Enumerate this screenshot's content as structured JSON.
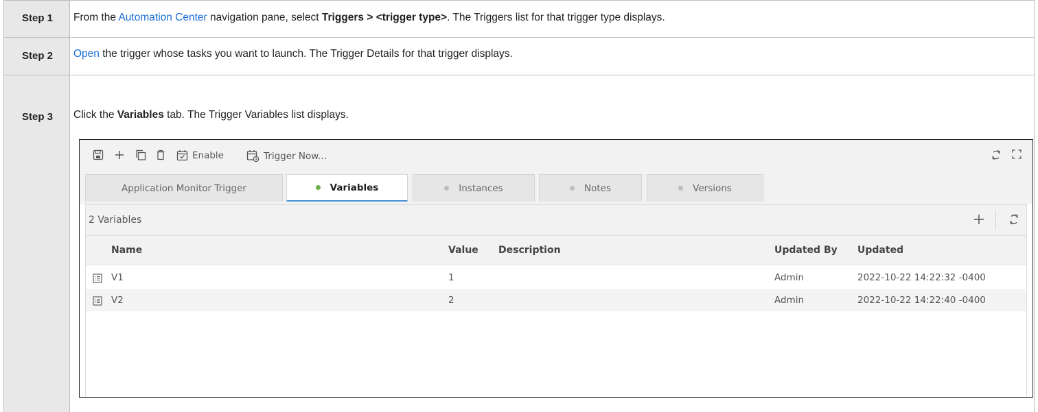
{
  "steps": [
    {
      "label": "Step 1",
      "parts": [
        {
          "t": "From the "
        },
        {
          "t": "Automation Center",
          "link": true
        },
        {
          "t": " navigation pane, select "
        },
        {
          "t": "Triggers > <trigger type>",
          "bold": true
        },
        {
          "t": ". The Triggers list for that trigger type displays."
        }
      ]
    },
    {
      "label": "Step 2",
      "parts": [
        {
          "t": "Open",
          "link": true
        },
        {
          "t": " the trigger whose tasks you want to launch. The Trigger Details for that trigger displays."
        }
      ]
    },
    {
      "label": "Step 3",
      "parts": [
        {
          "t": "Click the "
        },
        {
          "t": "Variables",
          "bold": true
        },
        {
          "t": " tab. The Trigger Variables list displays."
        }
      ]
    }
  ],
  "screenshot": {
    "toolbar": {
      "enable_label": "Enable",
      "trigger_now_label": "Trigger Now..."
    },
    "tabs": [
      {
        "label": "Application Monitor Trigger",
        "dot": false,
        "active": false
      },
      {
        "label": "Variables",
        "dot": true,
        "active": true
      },
      {
        "label": "Instances",
        "dot": true,
        "active": false
      },
      {
        "label": "Notes",
        "dot": true,
        "active": false
      },
      {
        "label": "Versions",
        "dot": true,
        "active": false
      }
    ],
    "variables_count": "2 Variables",
    "columns": {
      "name": "Name",
      "value": "Value",
      "description": "Description",
      "updated_by": "Updated By",
      "updated": "Updated"
    },
    "rows": [
      {
        "name": "V1",
        "value": "1",
        "description": "",
        "updated_by": "Admin",
        "updated": "2022-10-22 14:22:32 -0400"
      },
      {
        "name": "V2",
        "value": "2",
        "description": "",
        "updated_by": "Admin",
        "updated": "2022-10-22 14:22:40 -0400"
      }
    ]
  },
  "colors": {
    "link": "#1a6ed8",
    "active_tab_underline": "#4a90d9",
    "active_dot": "#6ab04c",
    "label_cell_bg": "#e8e8e8"
  }
}
